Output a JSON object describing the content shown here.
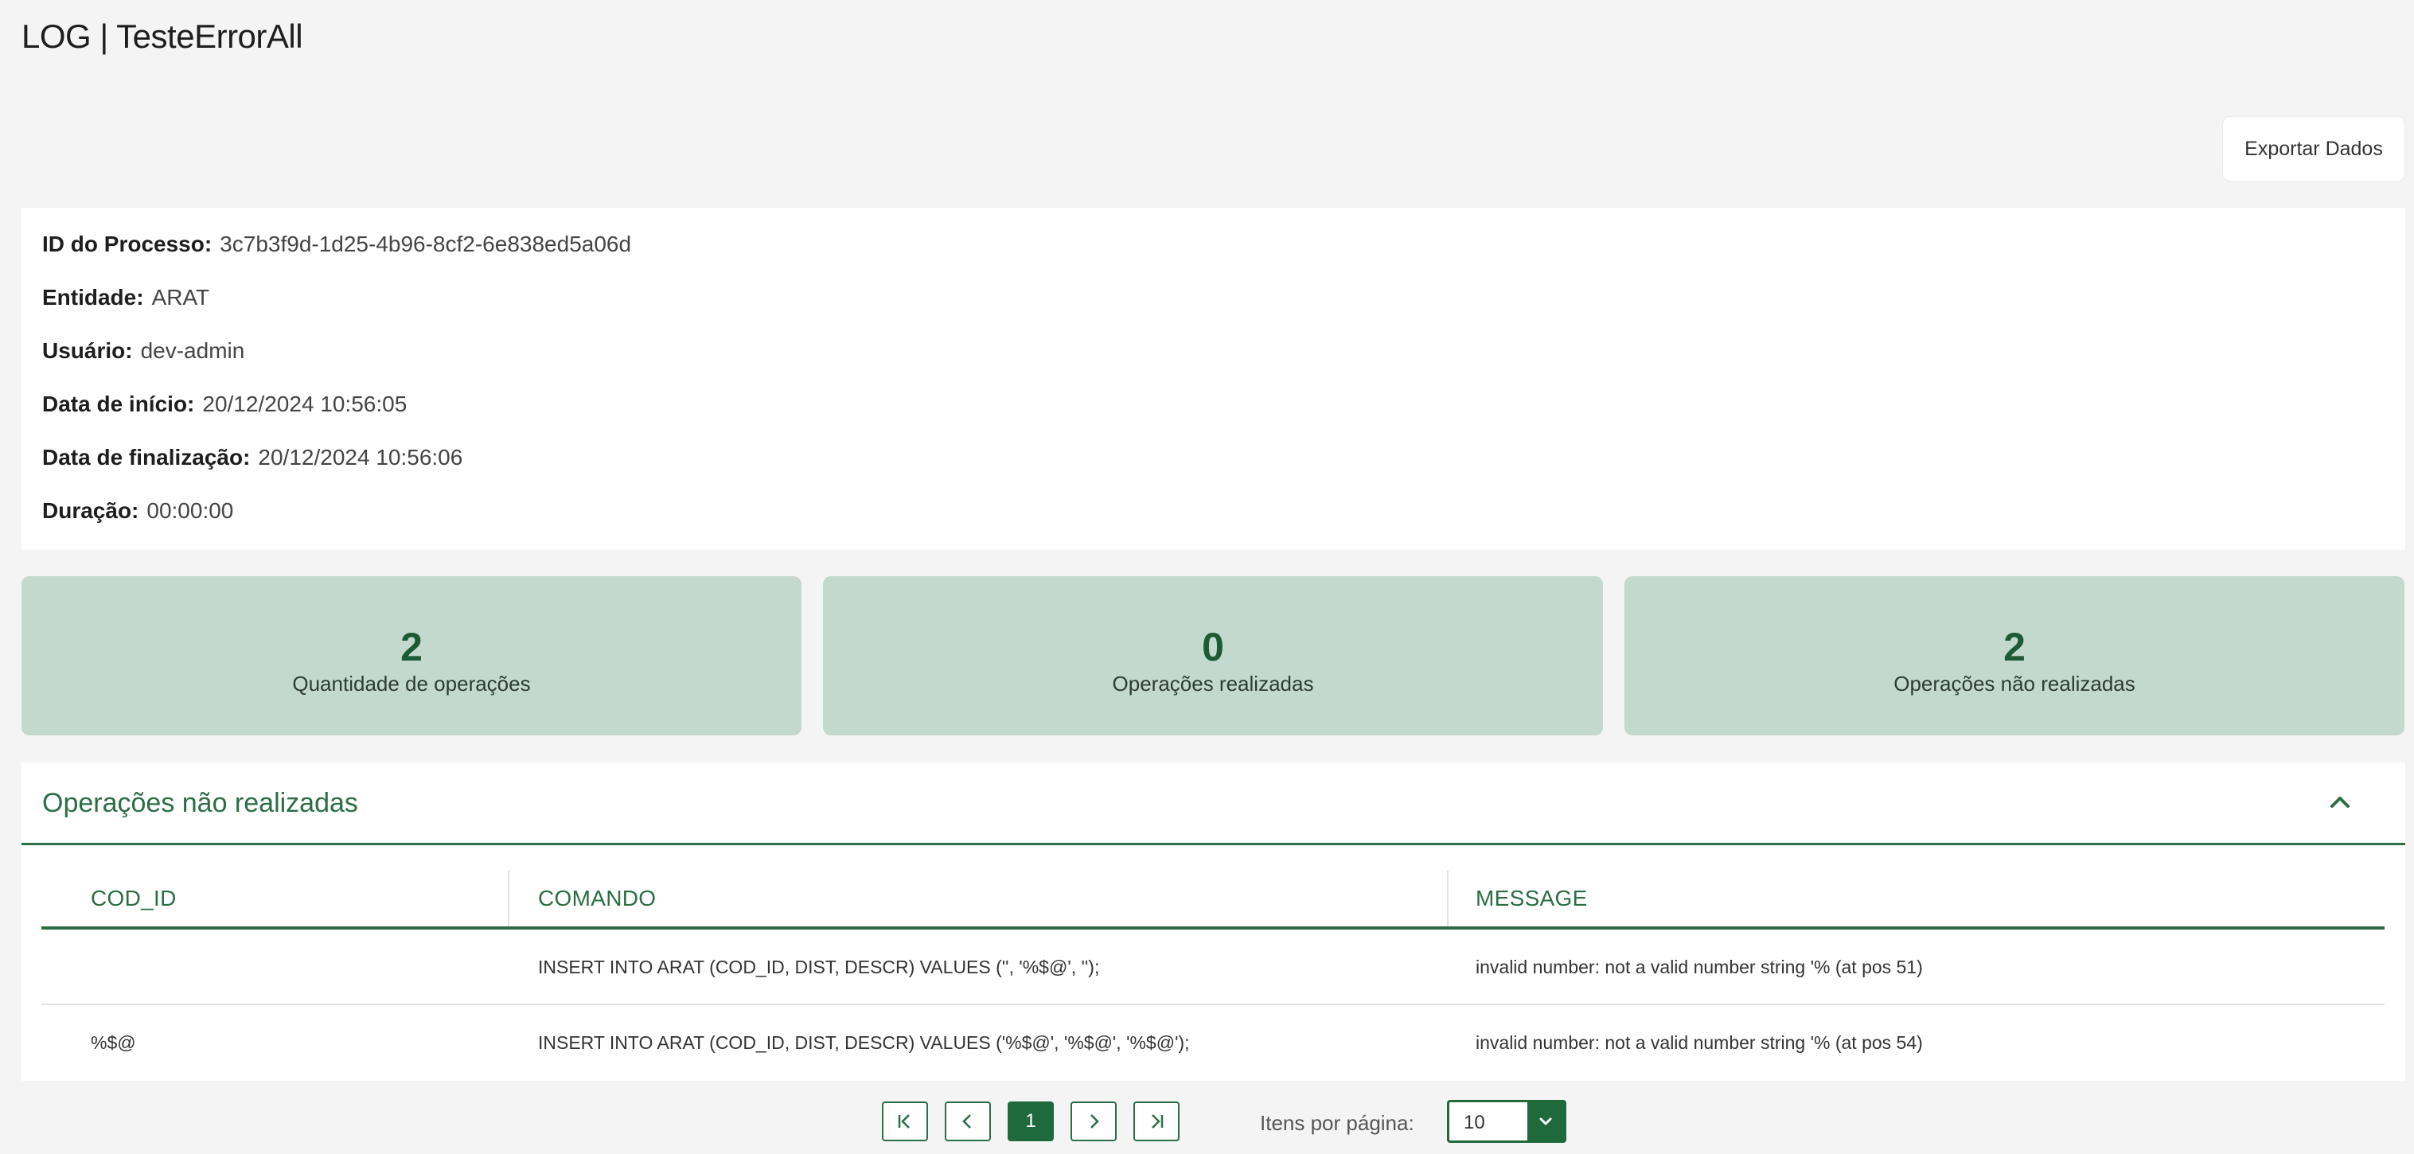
{
  "page": {
    "title": "LOG | TesteErrorAll"
  },
  "toolbar": {
    "export_label": "Exportar Dados"
  },
  "info": [
    {
      "label": "ID do Processo:",
      "value": "3c7b3f9d-1d25-4b96-8cf2-6e838ed5a06d"
    },
    {
      "label": "Entidade:",
      "value": "ARAT"
    },
    {
      "label": "Usuário:",
      "value": "dev-admin"
    },
    {
      "label": "Data de início:",
      "value": "20/12/2024 10:56:05"
    },
    {
      "label": "Data de finalização:",
      "value": "20/12/2024 10:56:06"
    },
    {
      "label": "Duração:",
      "value": "00:00:00"
    }
  ],
  "stats": [
    {
      "value": "2",
      "label": "Quantidade de operações"
    },
    {
      "value": "0",
      "label": "Operações realizadas"
    },
    {
      "value": "2",
      "label": "Operações não realizadas"
    }
  ],
  "failed_ops": {
    "title": "Operações não realizadas",
    "columns": [
      "COD_ID",
      "COMANDO",
      "MESSAGE"
    ],
    "rows": [
      {
        "cod_id": "",
        "comando": "INSERT INTO ARAT (COD_ID, DIST, DESCR) VALUES ('', '%$@', '');",
        "message": "invalid number: not a valid number string '% (at pos 51)"
      },
      {
        "cod_id": "%$@",
        "comando": "INSERT INTO ARAT (COD_ID, DIST, DESCR) VALUES ('%$@', '%$@', '%$@');",
        "message": "invalid number: not a valid number string '% (at pos 54)"
      }
    ]
  },
  "pagination": {
    "current_page": "1",
    "items_label": "Itens por página:",
    "items_per_page": "10"
  },
  "colors": {
    "accent": "#2b6e46",
    "stat_bg": "#c3d9cd",
    "page_bg": "#f3f4f3"
  }
}
